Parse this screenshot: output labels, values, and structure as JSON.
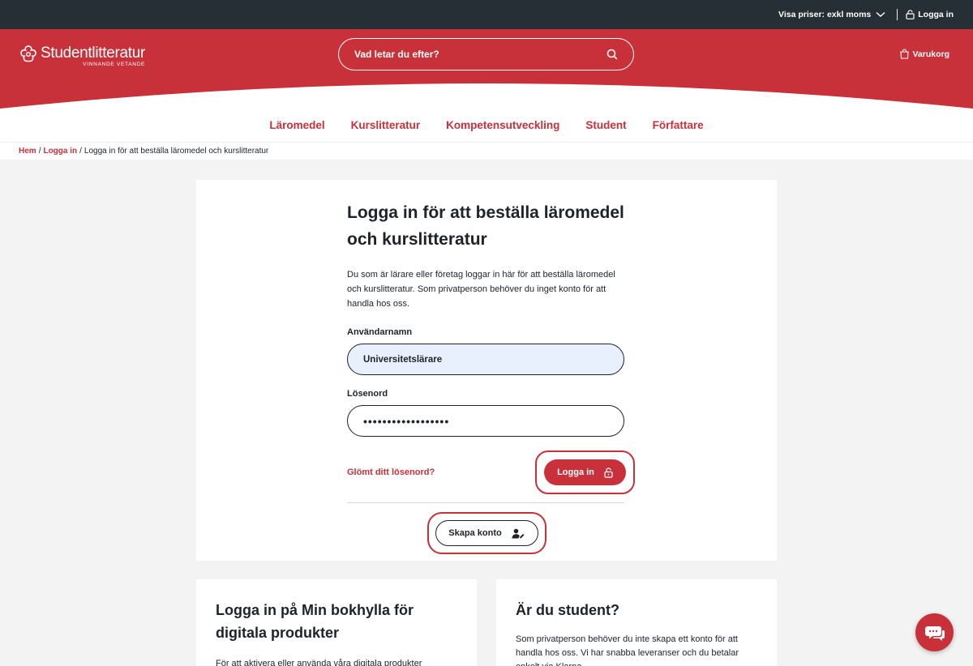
{
  "topbar": {
    "prices_label": "Visa priser: exkl moms",
    "login_label": "Logga in"
  },
  "header": {
    "logo_name": "Studentlitteratur",
    "logo_tagline": "VINNANDE VETANDE",
    "search_placeholder": "Vad letar du efter?",
    "cart_label": "Varukorg"
  },
  "nav": {
    "items": [
      "Läromedel",
      "Kurslitteratur",
      "Kompetensutveckling",
      "Student",
      "Författare"
    ]
  },
  "breadcrumb": {
    "home": "Hem",
    "login": "Logga in",
    "current": "Logga in för att beställa läromedel och kurslitteratur"
  },
  "login": {
    "title": "Logga in för att beställa läromedel och kurslitteratur",
    "intro": "Du som är lärare eller företag loggar in här för att beställa läromedel och kurslitteratur. Som privatperson behöver du inget konto för att handla hos oss.",
    "username_label": "Användarnamn",
    "username_value": "Universitetslärare",
    "password_label": "Lösenord",
    "password_value": "••••••••••••••••••",
    "forgot_label": "Glömt ditt lösenord?",
    "login_button": "Logga in",
    "create_button": "Skapa konto"
  },
  "bottom": {
    "left_title": "Logga in på Min bokhylla för digitala produkter",
    "left_text": "För att aktivera eller använda våra digitala produkter",
    "right_title": "Är du student?",
    "right_text": "Som privatperson behöver du inte skapa ett konto för att handla hos oss. Vi har snabba leveranser och du betalar enkelt via Klarna."
  },
  "colors": {
    "brand": "#c8313a",
    "dark": "#262f35",
    "autofill": "#e8f0fe"
  }
}
